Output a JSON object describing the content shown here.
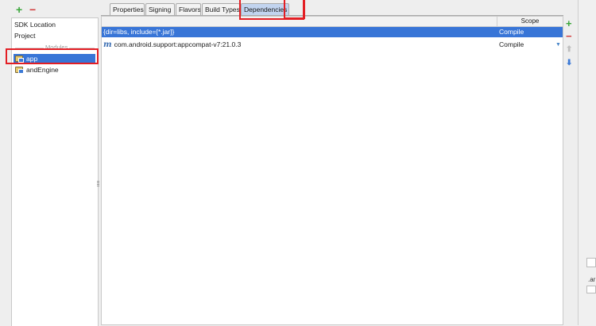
{
  "left_toolbar": {
    "add_label": "+",
    "remove_label": "−"
  },
  "sidebar": {
    "items": [
      {
        "label": "SDK Location"
      },
      {
        "label": "Project"
      }
    ],
    "modules_header": "Modules",
    "modules": [
      {
        "label": "app",
        "selected": true
      },
      {
        "label": "andEngine",
        "selected": false
      }
    ]
  },
  "tabs": [
    {
      "label": "Properties",
      "active": false
    },
    {
      "label": "Signing",
      "active": false
    },
    {
      "label": "Flavors",
      "active": false
    },
    {
      "label": "Build Types",
      "active": false
    },
    {
      "label": "Dependencies",
      "active": true
    }
  ],
  "table": {
    "columns": [
      "",
      "Scope"
    ],
    "rows": [
      {
        "dependency": "{dir=libs, include=[*.jar]}",
        "scope": "Compile",
        "icon": "",
        "selected": true
      },
      {
        "dependency": "com.android.support:appcompat-v7:21.0.3",
        "scope": "Compile",
        "icon": "maven-icon",
        "icon_glyph": "m",
        "selected": false
      }
    ],
    "dropdown_glyph": "▼"
  },
  "right_toolbar": {
    "add_label": "+",
    "remove_label": "−",
    "up_label": "⬆",
    "down_label": "⬇"
  },
  "colors": {
    "selection": "#3875d7",
    "highlight": "#e31e24",
    "add": "#3aa63a",
    "remove": "#d23c3c"
  },
  "right_fragment": {
    "text": ".ar"
  }
}
